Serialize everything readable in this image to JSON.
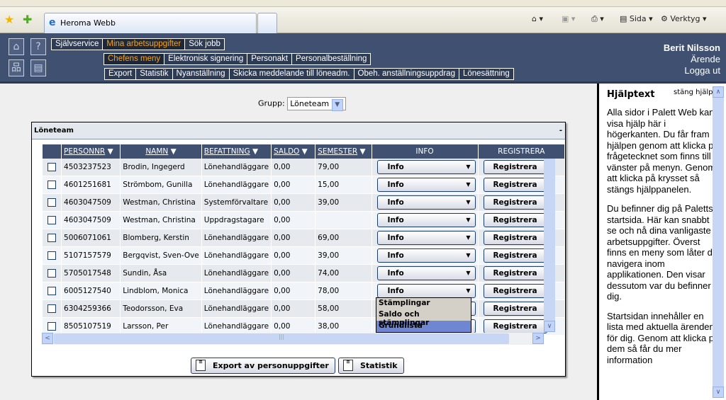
{
  "browser": {
    "tab_title": "Heroma Webb",
    "toolbar": {
      "page": "Sida",
      "tools": "Verktyg"
    }
  },
  "header": {
    "menu1": [
      "Självservice",
      "Mina arbetsuppgifter",
      "Sök jobb"
    ],
    "menu2": [
      "Chefens meny",
      "Elektronisk signering",
      "Personakt",
      "Personalbeställning"
    ],
    "menu3": [
      "Export",
      "Statistik",
      "Nyanställning",
      "Skicka meddelande till löneadm.",
      "Obeh. anställningsuppdrag",
      "Lönesättning"
    ],
    "user": "Berit Nilsson",
    "arende": "Ärende",
    "logout": "Logga ut"
  },
  "filter": {
    "label": "Grupp:",
    "value": "Löneteam"
  },
  "panel": {
    "title": "Löneteam",
    "collapse": "-",
    "columns": [
      "PERSONNR",
      "NAMN",
      "BEFATTNING",
      "SALDO",
      "SEMESTER",
      "INFO",
      "REGISTRERA"
    ],
    "rows": [
      [
        "4503237523",
        "Brodin, Ingegerd",
        "Lönehandläggare",
        "0,00",
        "79,00"
      ],
      [
        "4601251681",
        "Strömbom, Gunilla",
        "Lönehandläggare",
        "0,00",
        "15,00"
      ],
      [
        "4603047509",
        "Westman, Christina",
        "Systemförvaltare",
        "0,00",
        "39,00"
      ],
      [
        "4603047509",
        "Westman, Christina",
        "Uppdragstagare",
        "0,00",
        ""
      ],
      [
        "5006071061",
        "Blomberg, Kerstin",
        "Lönehandläggare",
        "0,00",
        "69,00"
      ],
      [
        "5107157579",
        "Bergqvist, Sven-Ove",
        "Lönehandläggare",
        "0,00",
        "39,00"
      ],
      [
        "5705017548",
        "Sundin, Åsa",
        "Lönehandläggare",
        "0,00",
        "74,00"
      ],
      [
        "6005127540",
        "Lindblom, Monica",
        "Lönehandläggare",
        "0,00",
        "78,00"
      ],
      [
        "6304259366",
        "Teodorsson, Eva",
        "Lönehandläggare",
        "0,00",
        "58,00"
      ],
      [
        "8505107519",
        "Larsson, Per",
        "Lönehandläggare",
        "0,00",
        "38,00"
      ]
    ],
    "info_label": "Info",
    "register_label": "Registrera",
    "dropdown": {
      "options": [
        "Stämplingar",
        "Saldo och stämplingar",
        "Grundlista"
      ],
      "highlighted": "Grundlista"
    },
    "export_button": "Export av personuppgifter",
    "stats_button": "Statistik"
  },
  "help": {
    "title": "Hjälptext",
    "close": "stäng hjälp",
    "paragraphs": [
      "Alla sidor i Palett Web kan visa hjälp här i högerkanten. Du får fram hjälpen genom att klicka på frågetecknet som finns till vänster på menyn. Genom att klicka på krysset så stängs hjälppanelen.",
      "Du befinner dig på Paletts startsida. Här kan snabbt se och nå dina vanligaste arbetsuppgifter. Överst finns en meny som låter dig navigera inom applikationen. Den visar dessutom var du befinner dig.",
      "Startsidan innehåller en lista med aktuella ärenden för dig. Genom att klicka på dem så får du mer information"
    ]
  }
}
